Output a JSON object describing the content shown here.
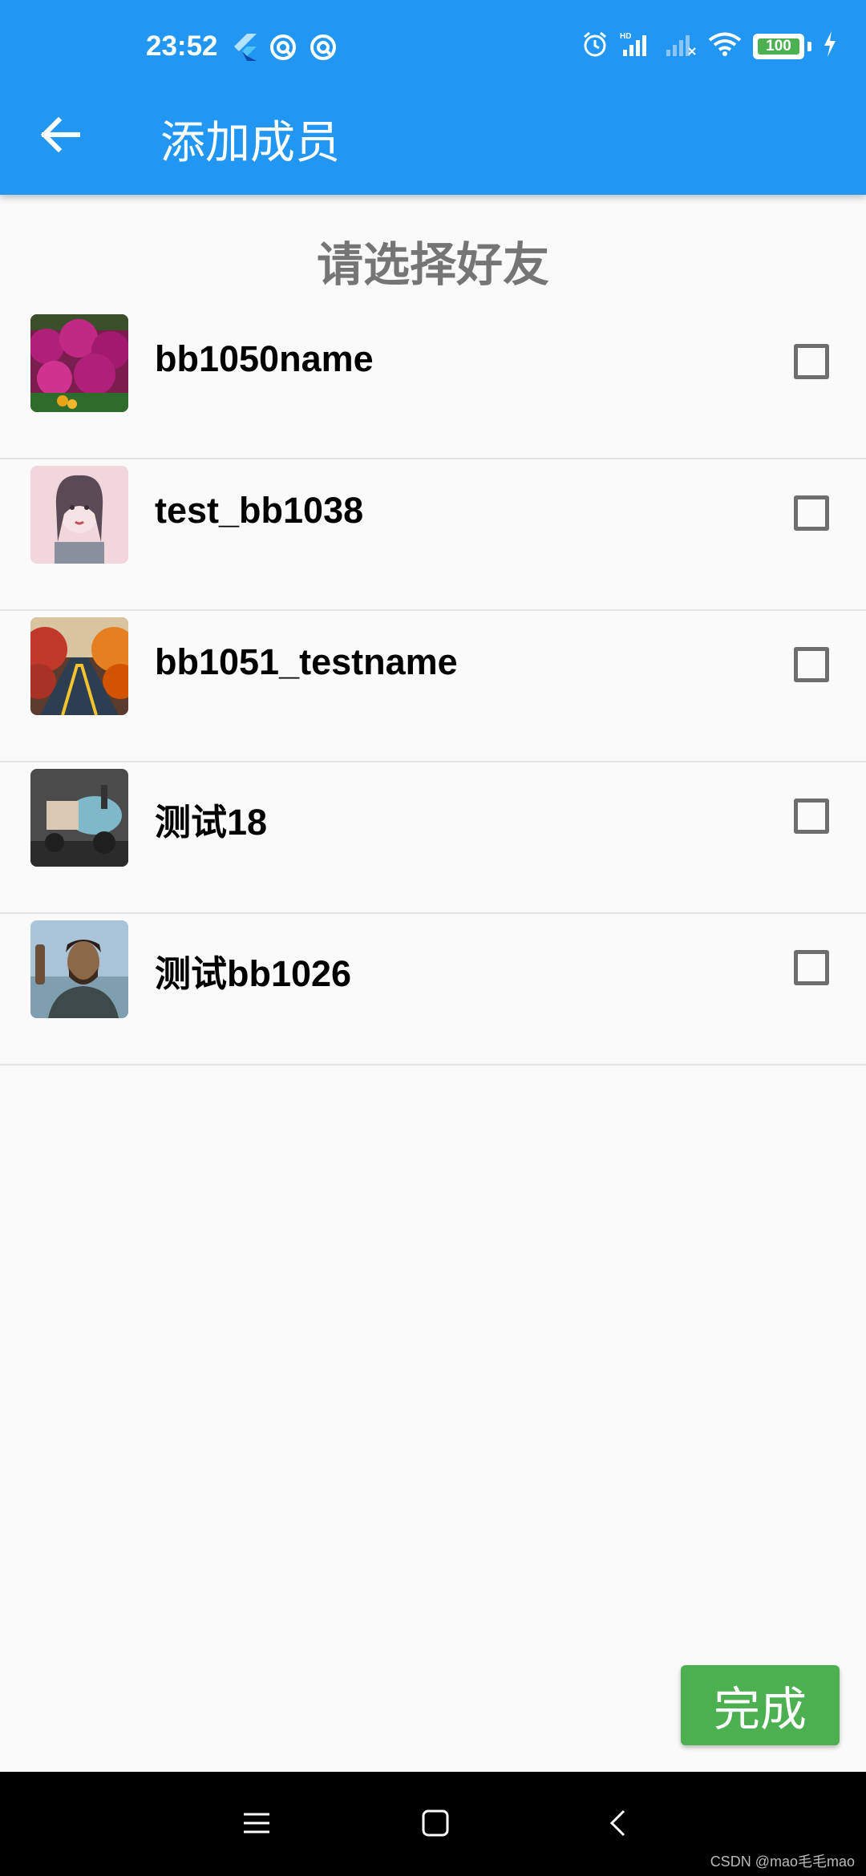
{
  "status_bar": {
    "time": "23:52",
    "battery": "100",
    "left_icons": [
      "flutter-icon",
      "app-notification-icon",
      "app-notification-icon"
    ],
    "right_icons": [
      "alarm-icon",
      "signal-hd-icon",
      "signal-empty-icon",
      "wifi-icon",
      "battery-icon",
      "charging-icon"
    ]
  },
  "header": {
    "title": "添加成员",
    "back_icon": "arrow-left-icon"
  },
  "subtitle": "请选择好友",
  "friends": [
    {
      "name": "bb1050name",
      "checked": false,
      "avatar_colors": [
        "#b0207a",
        "#7a1d4f",
        "#2f6b2a",
        "#e8a417"
      ]
    },
    {
      "name": "test_bb1038",
      "checked": false,
      "avatar_colors": [
        "#f1d7dc",
        "#8a6f7e",
        "#5a4a55",
        "#d9c5cc"
      ]
    },
    {
      "name": "bb1051_testname",
      "checked": false,
      "avatar_colors": [
        "#c0392b",
        "#e67e22",
        "#2c3e50",
        "#f4c430"
      ]
    },
    {
      "name": "测试18",
      "checked": false,
      "avatar_colors": [
        "#4b4b4b",
        "#7fb8c9",
        "#d9c9b2",
        "#2b2b2b"
      ]
    },
    {
      "name": "测试bb1026",
      "checked": false,
      "avatar_colors": [
        "#a9c3d8",
        "#8a6848",
        "#3e4a4a",
        "#cfd8df"
      ]
    }
  ],
  "done_button": "完成",
  "nav_bar": {
    "menu_icon": "menu-icon",
    "home_icon": "home-square-icon",
    "back_icon": "back-chevron-icon"
  },
  "watermark": "CSDN @mao毛毛mao"
}
